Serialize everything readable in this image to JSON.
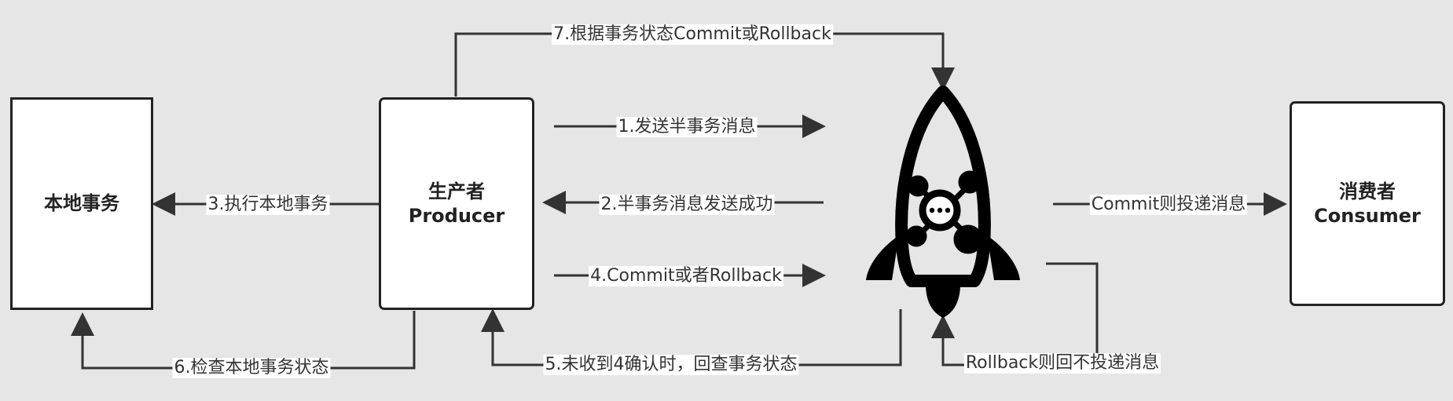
{
  "nodes": {
    "local_tx": {
      "label": "本地事务"
    },
    "producer": {
      "line1": "生产者",
      "line2": "Producer"
    },
    "broker": {
      "icon": "rocket-icon"
    },
    "consumer": {
      "line1": "消费者",
      "line2": "Consumer"
    }
  },
  "edges": {
    "e1": "1.发送半事务消息",
    "e2": "2.半事务消息发送成功",
    "e3": "3.执行本地事务",
    "e4": "4.Commit或者Rollback",
    "e5": "5.未收到4确认时，回查事务状态",
    "e6": "6.检查本地事务状态",
    "e7": "7.根据事务状态Commit或Rollback",
    "commit": "Commit则投递消息",
    "rollback": "Rollback则回不投递消息"
  },
  "colors": {
    "background": "#e6e6e6",
    "line": "#333333",
    "box_border": "#222222"
  }
}
